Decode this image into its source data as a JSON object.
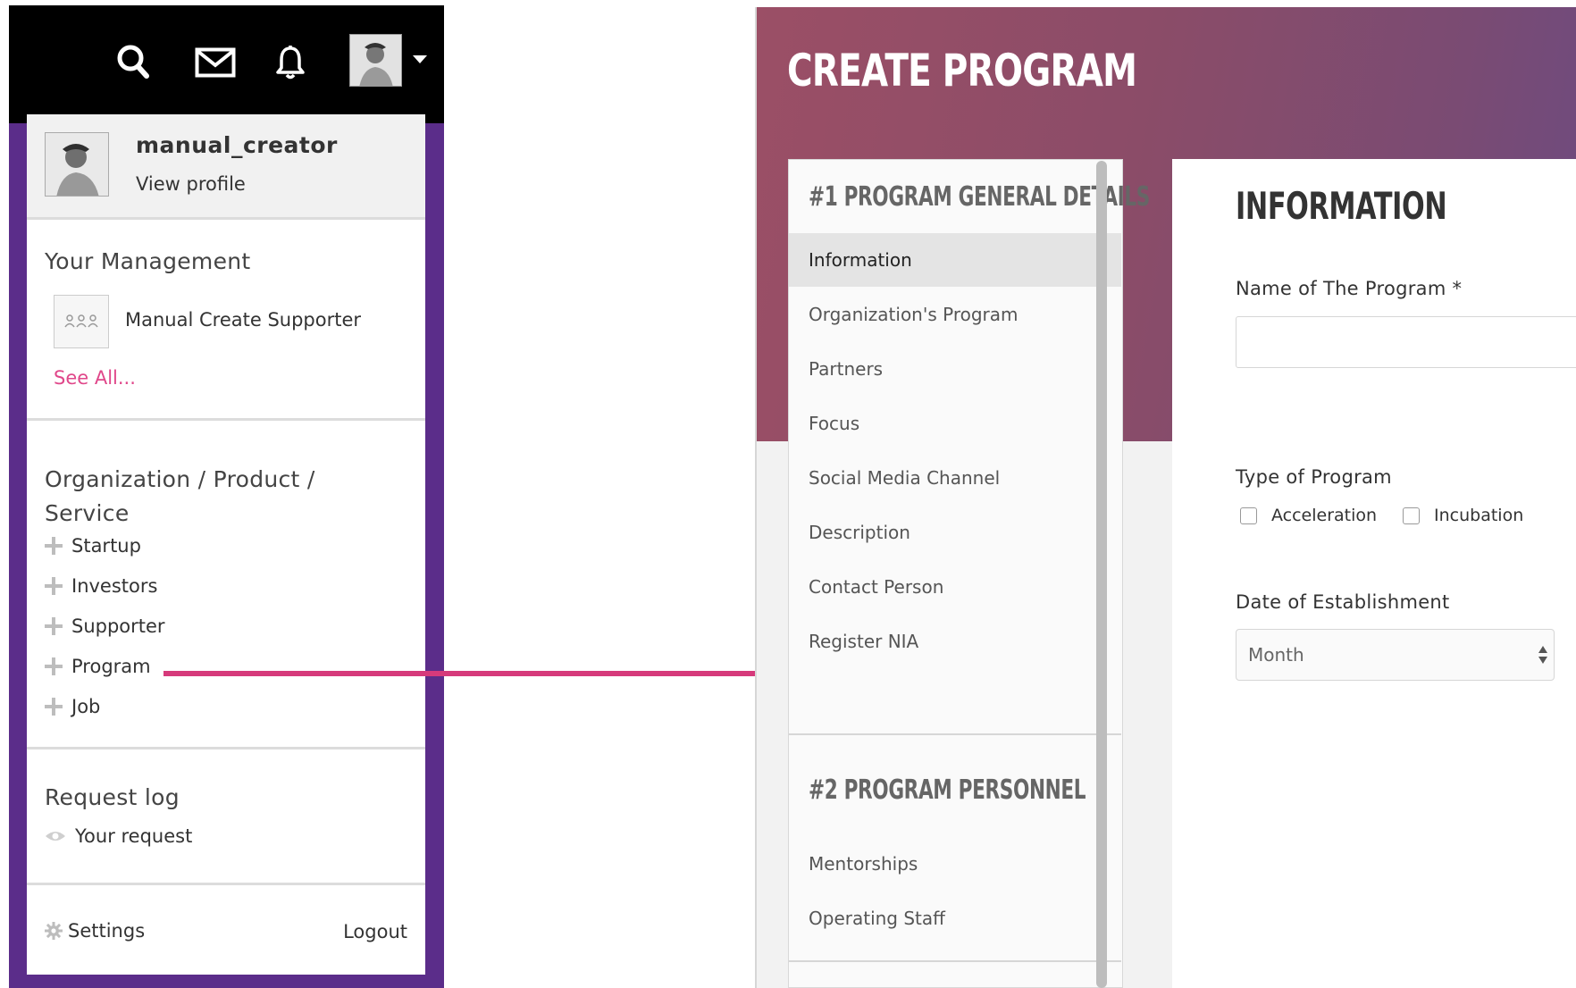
{
  "topbar": {
    "icons": [
      "search-icon",
      "mail-icon",
      "bell-icon"
    ],
    "avatar": "user-avatar"
  },
  "profile": {
    "username": "manual_creator",
    "view_profile": "View profile"
  },
  "management": {
    "title": "Your Management",
    "supporter_name": "Manual Create Supporter",
    "see_all": "See All..."
  },
  "org": {
    "title": "Organization / Product / Service",
    "items": [
      {
        "label": "Startup"
      },
      {
        "label": "Investors"
      },
      {
        "label": "Supporter"
      },
      {
        "label": "Program"
      },
      {
        "label": "Job"
      }
    ]
  },
  "request_log": {
    "title": "Request log",
    "your_request": "Your request"
  },
  "footer": {
    "settings": "Settings",
    "logout": "Logout"
  },
  "colors": {
    "sidebar_purple": "#5b2d8a",
    "accent_pink": "#e0478a",
    "connector": "#d63a7b",
    "hero_gradient_start": "#9b4f66",
    "hero_gradient_end": "#6d4b80"
  },
  "program_page": {
    "title": "CREATE PROGRAM",
    "step1": {
      "heading": "#1 PROGRAM GENERAL DETAILS",
      "items": [
        {
          "label": "Information"
        },
        {
          "label": "Organization's Program"
        },
        {
          "label": "Partners"
        },
        {
          "label": "Focus"
        },
        {
          "label": "Social Media Channel"
        },
        {
          "label": "Description"
        },
        {
          "label": "Contact Person"
        },
        {
          "label": "Register NIA"
        }
      ]
    },
    "step2": {
      "heading": "#2 PROGRAM PERSONNEL",
      "items": [
        {
          "label": "Mentorships"
        },
        {
          "label": "Operating Staff"
        }
      ]
    },
    "form": {
      "title": "INFORMATION",
      "name_label": "Name of The Program *",
      "name_value": "",
      "type_label": "Type of Program",
      "type_options": [
        {
          "label": "Acceleration",
          "checked": false
        },
        {
          "label": "Incubation",
          "checked": false
        }
      ],
      "date_label": "Date of Establishment",
      "month_selected": "Month"
    }
  }
}
